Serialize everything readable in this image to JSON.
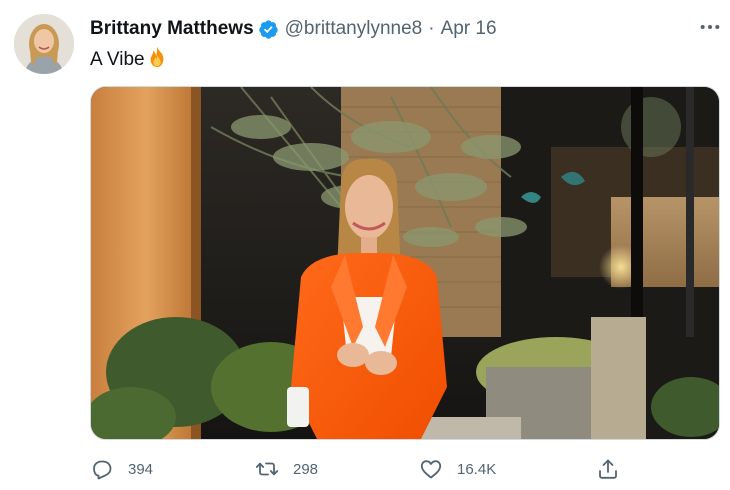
{
  "tweet": {
    "author_name": "Brittany Matthews",
    "handle": "@brittanylynne8",
    "separator": "·",
    "date": "Apr 16",
    "text": "A Vibe",
    "text_emoji": "fire-emoji",
    "verified": true,
    "photo_description_icon": "tweet-photo"
  },
  "actions": {
    "reply_count": "394",
    "retweet_count": "298",
    "like_count": "16.4K"
  },
  "colors": {
    "verified_blue": "#1d9bf0",
    "secondary_text": "#536471",
    "primary_text": "#0f1419",
    "jacket_orange": "#ff5a12"
  },
  "icons": {
    "more": "more-dots-icon",
    "reply": "reply-bubble-icon",
    "retweet": "retweet-arrows-icon",
    "like": "heart-icon",
    "share": "share-upload-icon"
  }
}
